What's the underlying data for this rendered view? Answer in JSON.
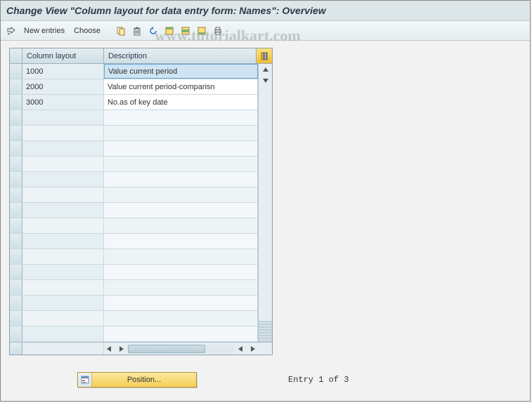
{
  "title": "Change View \"Column layout for data entry form: Names\": Overview",
  "watermark": "www.tutorialkart.com",
  "toolbar": {
    "new_entries": "New entries",
    "choose": "Choose"
  },
  "table": {
    "headers": {
      "col1": "Column layout",
      "col2": "Description"
    },
    "rows": [
      {
        "layout": "1000",
        "desc": "Value current period",
        "selected": true
      },
      {
        "layout": "2000",
        "desc": "Value current period-comparisn",
        "selected": false
      },
      {
        "layout": "3000",
        "desc": "No.as of key date",
        "selected": false
      }
    ],
    "empty_rows": 15
  },
  "footer": {
    "position_btn": "Position...",
    "entry_text": "Entry 1 of 3"
  }
}
